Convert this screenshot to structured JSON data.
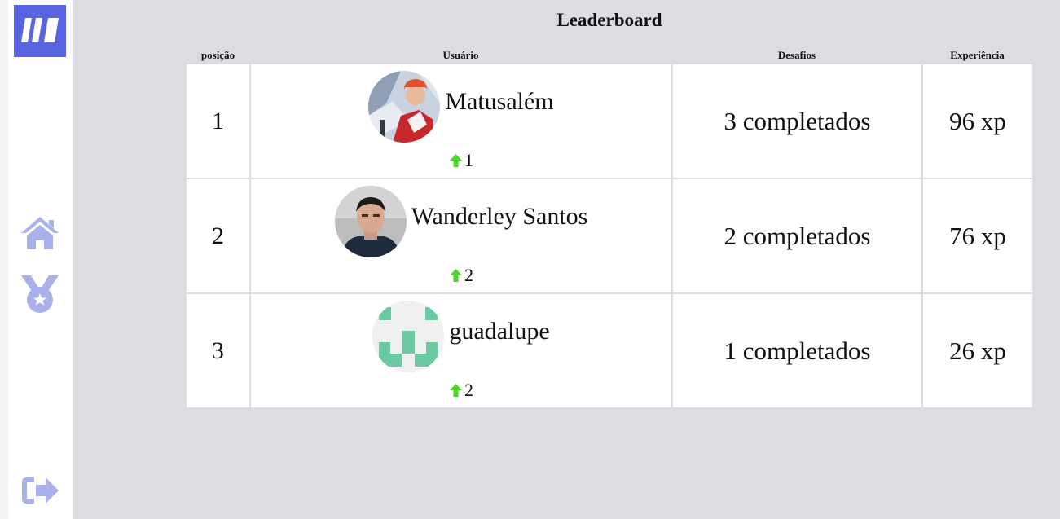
{
  "app": {
    "title": "Leaderboard",
    "accent_color": "#5965e0",
    "icon_color": "#aab0ea",
    "level_up_color": "#4cd62b"
  },
  "sidebar": {
    "logo": "moveit-logo",
    "items": [
      {
        "icon": "home-icon"
      },
      {
        "icon": "award-medal-icon"
      }
    ],
    "logout_icon": "logout-icon"
  },
  "table": {
    "headers": {
      "position": "posição",
      "user": "Usuário",
      "challenges": "Desafios",
      "experience": "Experiência"
    },
    "rows": [
      {
        "position": "1",
        "name": "Matusalém",
        "level": "1",
        "challenges": "3 completados",
        "xp": "96 xp",
        "avatar": "photo-climber"
      },
      {
        "position": "2",
        "name": "Wanderley Santos",
        "level": "2",
        "challenges": "2 completados",
        "xp": "76 xp",
        "avatar": "photo-man"
      },
      {
        "position": "3",
        "name": "guadalupe",
        "level": "2",
        "challenges": "1 completados",
        "xp": "26 xp",
        "avatar": "identicon-green"
      }
    ]
  }
}
